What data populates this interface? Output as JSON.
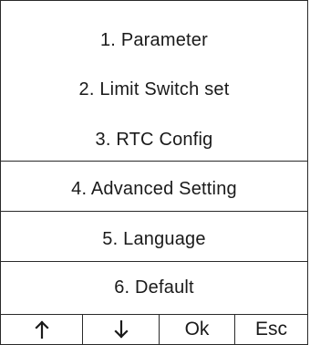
{
  "menu": {
    "items": [
      {
        "label": "1. Parameter"
      },
      {
        "label": "2. Limit Switch set"
      },
      {
        "label": "3. RTC Config"
      },
      {
        "label": "4. Advanced Setting"
      },
      {
        "label": "5. Language"
      },
      {
        "label": "6. Default"
      }
    ]
  },
  "buttons": {
    "up": {
      "icon": "up-arrow-icon"
    },
    "down": {
      "icon": "down-arrow-icon"
    },
    "ok": {
      "label": "Ok"
    },
    "esc": {
      "label": "Esc"
    }
  }
}
